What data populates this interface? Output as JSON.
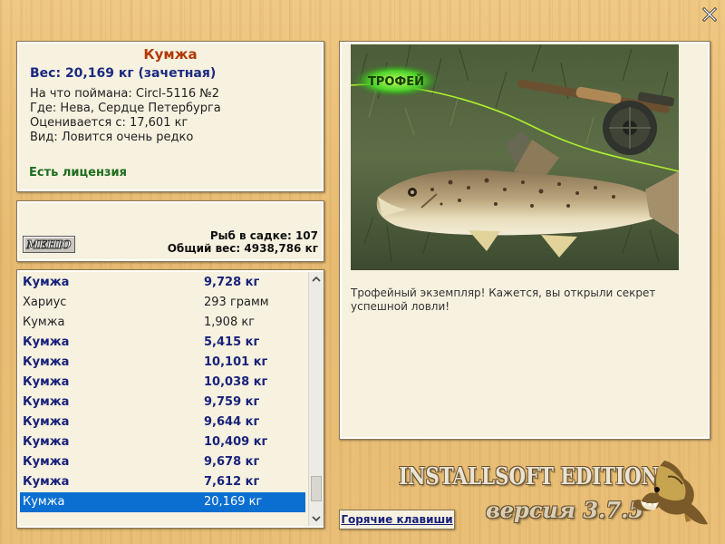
{
  "window": {
    "close_icon": "close-x-icon"
  },
  "catch_info": {
    "fish_name": "Кумжа",
    "weight_line": "Вес: 20,169 кг (зачетная)",
    "bait_line": "На что поймана: Circl-5116 №2",
    "place_line": "Где: Нева, Сердце Петербурга",
    "rated_line": "Оценивается с: 17,601 кг",
    "type_line": "Вид: Ловится очень редко",
    "license": "Есть лицензия"
  },
  "stats": {
    "menu_button": "МЕНЮ",
    "fish_in_keepnet": "Рыб в садке: 107",
    "total_weight": "Общий вес: 4938,786 кг"
  },
  "catch_list": [
    {
      "name": "Кумжа",
      "weight": "9,728 кг",
      "style": "trophy"
    },
    {
      "name": "Хариус",
      "weight": "293 грамм",
      "style": "normal"
    },
    {
      "name": "Кумжа",
      "weight": "1,908 кг",
      "style": "normal"
    },
    {
      "name": "Кумжа",
      "weight": "5,415 кг",
      "style": "trophy"
    },
    {
      "name": "Кумжа",
      "weight": "10,101 кг",
      "style": "trophy"
    },
    {
      "name": "Кумжа",
      "weight": "10,038 кг",
      "style": "trophy"
    },
    {
      "name": "Кумжа",
      "weight": "9,759 кг",
      "style": "trophy"
    },
    {
      "name": "Кумжа",
      "weight": "9,644 кг",
      "style": "trophy"
    },
    {
      "name": "Кумжа",
      "weight": "10,409 кг",
      "style": "trophy"
    },
    {
      "name": "Кумжа",
      "weight": "9,678 кг",
      "style": "trophy"
    },
    {
      "name": "Кумжа",
      "weight": "7,612 кг",
      "style": "trophy"
    },
    {
      "name": "Кумжа",
      "weight": "20,169 кг",
      "style": "selected"
    }
  ],
  "scroll_position": 0.95,
  "photo": {
    "trophy_badge": "ТРОФЕЙ",
    "description": "Трофейный экземпляр! Кажется, вы открыли секрет успешной ловли!"
  },
  "hotkeys_button": "Горячие клавиши",
  "branding": {
    "edition": "INSTALLSOFT EDITION",
    "version": "версия 3.7.5"
  },
  "colors": {
    "title_red": "#b03a0a",
    "trophy_blue": "#18227a",
    "license_green": "#1d6d1d",
    "selection_blue": "#0b6fd1"
  }
}
